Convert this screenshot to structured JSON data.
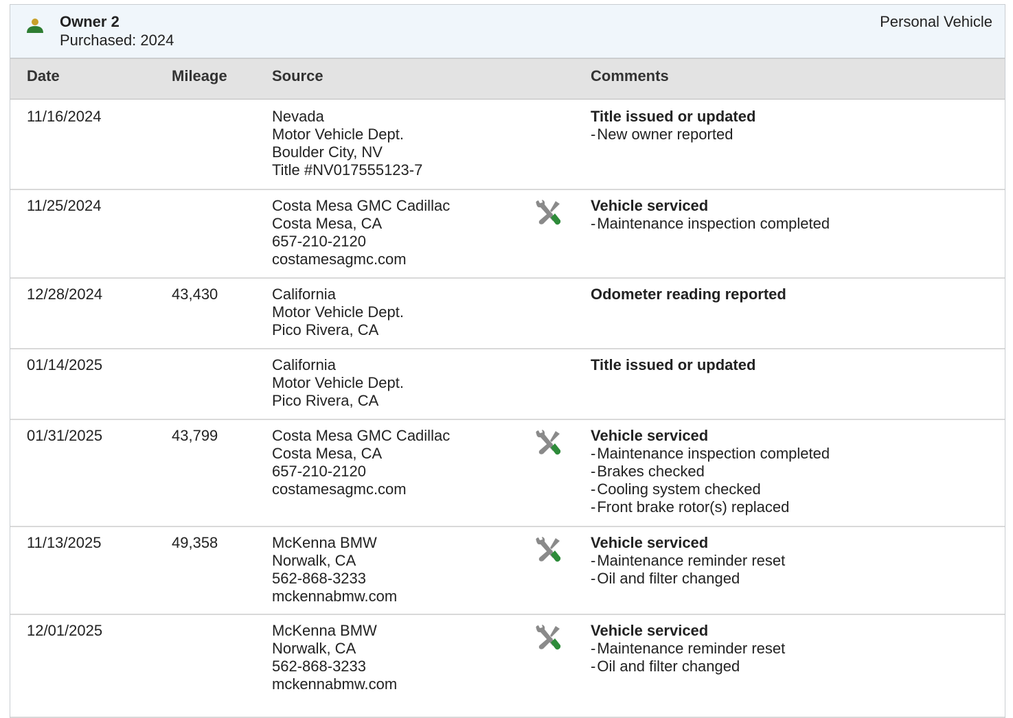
{
  "owner": {
    "title": "Owner 2",
    "purchased": "Purchased: 2024",
    "type": "Personal Vehicle"
  },
  "colors": {
    "owner_icon_head": "#c8a02a",
    "owner_icon_body": "#2e7d32",
    "wrench_gray": "#8a8a8a",
    "screwdriver_green": "#2e8b3a",
    "header_bg": "#f0f6fb",
    "table_header_bg": "#e3e3e3"
  },
  "table": {
    "headers": {
      "date": "Date",
      "mileage": "Mileage",
      "source": "Source",
      "comments": "Comments"
    },
    "rows": [
      {
        "date": "11/16/2024",
        "mileage": "",
        "source": [
          "Nevada",
          "Motor Vehicle Dept.",
          "Boulder City, NV",
          "Title #NV017555123-7"
        ],
        "icon": "",
        "comment_title": "Title issued or updated",
        "comment_items": [
          "New owner reported"
        ]
      },
      {
        "date": "11/25/2024",
        "mileage": "",
        "source": [
          "Costa Mesa GMC Cadillac",
          "Costa Mesa, CA",
          "657-210-2120",
          "costamesagmc.com"
        ],
        "icon": "service-tools-icon",
        "comment_title": "Vehicle serviced",
        "comment_items": [
          "Maintenance inspection completed"
        ]
      },
      {
        "date": "12/28/2024",
        "mileage": "43,430",
        "source": [
          "California",
          "Motor Vehicle Dept.",
          "Pico Rivera, CA"
        ],
        "icon": "",
        "comment_title": "Odometer reading reported",
        "comment_items": []
      },
      {
        "date": "01/14/2025",
        "mileage": "",
        "source": [
          "California",
          "Motor Vehicle Dept.",
          "Pico Rivera, CA"
        ],
        "icon": "",
        "comment_title": "Title issued or updated",
        "comment_items": []
      },
      {
        "date": "01/31/2025",
        "mileage": "43,799",
        "source": [
          "Costa Mesa GMC Cadillac",
          "Costa Mesa, CA",
          "657-210-2120",
          "costamesagmc.com"
        ],
        "icon": "service-tools-icon",
        "comment_title": "Vehicle serviced",
        "comment_items": [
          "Maintenance inspection completed",
          "Brakes checked",
          "Cooling system checked",
          "Front brake rotor(s) replaced"
        ]
      },
      {
        "date": "11/13/2025",
        "mileage": "49,358",
        "source": [
          "McKenna BMW",
          "Norwalk, CA",
          "562-868-3233",
          "mckennabmw.com"
        ],
        "icon": "service-tools-icon",
        "comment_title": "Vehicle serviced",
        "comment_items": [
          "Maintenance reminder reset",
          "Oil and filter changed"
        ]
      },
      {
        "date": "12/01/2025",
        "mileage": "",
        "source": [
          "McKenna BMW",
          "Norwalk, CA",
          "562-868-3233",
          "mckennabmw.com"
        ],
        "icon": "service-tools-icon",
        "comment_title": "Vehicle serviced",
        "comment_items": [
          "Maintenance reminder reset",
          "Oil and filter changed"
        ]
      }
    ]
  }
}
